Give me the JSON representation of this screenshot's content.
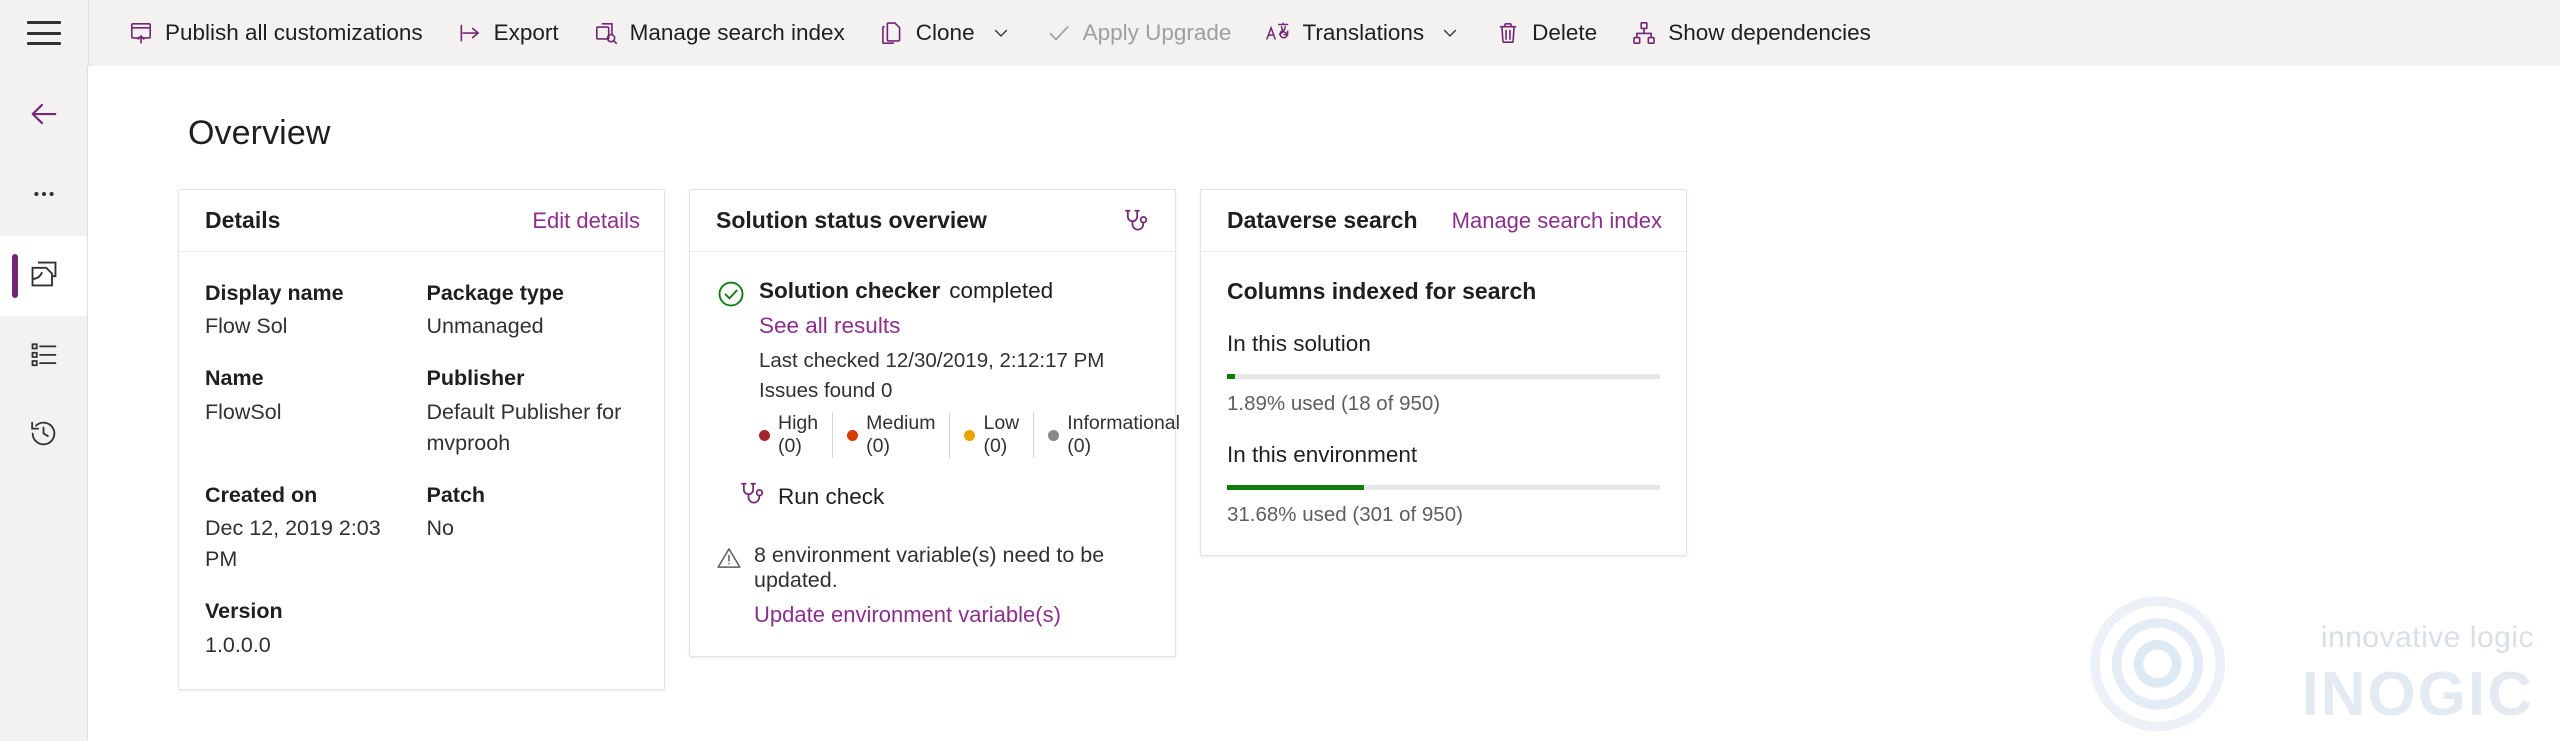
{
  "topbar": {
    "menu_icon": "hamburger-icon",
    "commands": [
      {
        "id": "publish-all-customizations",
        "label": "Publish all customizations",
        "icon": "publish-icon",
        "disabled": false,
        "has_chevron": false
      },
      {
        "id": "export",
        "label": "Export",
        "icon": "export-icon",
        "disabled": false,
        "has_chevron": false
      },
      {
        "id": "manage-search-index",
        "label": "Manage search index",
        "icon": "search-index-icon",
        "disabled": false,
        "has_chevron": false
      },
      {
        "id": "clone",
        "label": "Clone",
        "icon": "clone-icon",
        "disabled": false,
        "has_chevron": true
      },
      {
        "id": "apply-upgrade",
        "label": "Apply Upgrade",
        "icon": "checkmark-icon",
        "disabled": true,
        "has_chevron": false
      },
      {
        "id": "translations",
        "label": "Translations",
        "icon": "translations-icon",
        "disabled": false,
        "has_chevron": true
      },
      {
        "id": "delete",
        "label": "Delete",
        "icon": "trash-icon",
        "disabled": false,
        "has_chevron": false
      },
      {
        "id": "show-dependencies",
        "label": "Show dependencies",
        "icon": "dependencies-icon",
        "disabled": false,
        "has_chevron": false
      }
    ]
  },
  "rail": {
    "items": [
      {
        "id": "back",
        "icon": "back-arrow-icon",
        "selected": false
      },
      {
        "id": "more",
        "icon": "ellipsis-icon",
        "selected": false
      },
      {
        "id": "overview",
        "icon": "solution-icon",
        "selected": true
      },
      {
        "id": "objects",
        "icon": "list-icon",
        "selected": false
      },
      {
        "id": "history",
        "icon": "history-icon",
        "selected": false
      }
    ]
  },
  "page": {
    "title": "Overview"
  },
  "details_card": {
    "title": "Details",
    "edit_link": "Edit details",
    "fields": [
      {
        "label": "Display name",
        "value": "Flow Sol"
      },
      {
        "label": "Package type",
        "value": "Unmanaged"
      },
      {
        "label": "Name",
        "value": "FlowSol"
      },
      {
        "label": "Publisher",
        "value": "Default Publisher for mvprooh"
      },
      {
        "label": "Created on",
        "value": "Dec 12, 2019 2:03 PM"
      },
      {
        "label": "Patch",
        "value": "No"
      },
      {
        "label": "Version",
        "value": "1.0.0.0"
      },
      {
        "label": "",
        "value": ""
      }
    ]
  },
  "status_card": {
    "title": "Solution status overview",
    "header_icon": "stethoscope-icon",
    "checker_name": "Solution checker",
    "checker_state": "completed",
    "see_all_results": "See all results",
    "last_checked": "Last checked 12/30/2019, 2:12:17 PM",
    "issues_found": "Issues found 0",
    "severities": [
      {
        "label": "High (0)",
        "color": "#a4262c"
      },
      {
        "label": "Medium (0)",
        "color": "#d83b01"
      },
      {
        "label": "Low (0)",
        "color": "#eaa300"
      },
      {
        "label": "Informational (0)",
        "color": "#8a8886"
      }
    ],
    "run_check": "Run check",
    "warning_text": "8 environment variable(s) need to be updated.",
    "warning_link": "Update environment variable(s)"
  },
  "search_card": {
    "title": "Dataverse search",
    "manage_link": "Manage search index",
    "subtitle": "Columns indexed for search",
    "groups": [
      {
        "title": "In this solution",
        "usage": "1.89% used (18 of 950)",
        "percent": 1.89
      },
      {
        "title": "In this environment",
        "usage": "31.68% used (301 of 950)",
        "percent": 31.68
      }
    ],
    "bar_color": "#107c10"
  },
  "watermark": {
    "tagline": "innovative logic",
    "brand": "INOGIC"
  },
  "theme": {
    "accent": "#742774",
    "link": "#8c2f8c",
    "chrome_bg": "#f3f2f1",
    "success": "#107c10"
  }
}
